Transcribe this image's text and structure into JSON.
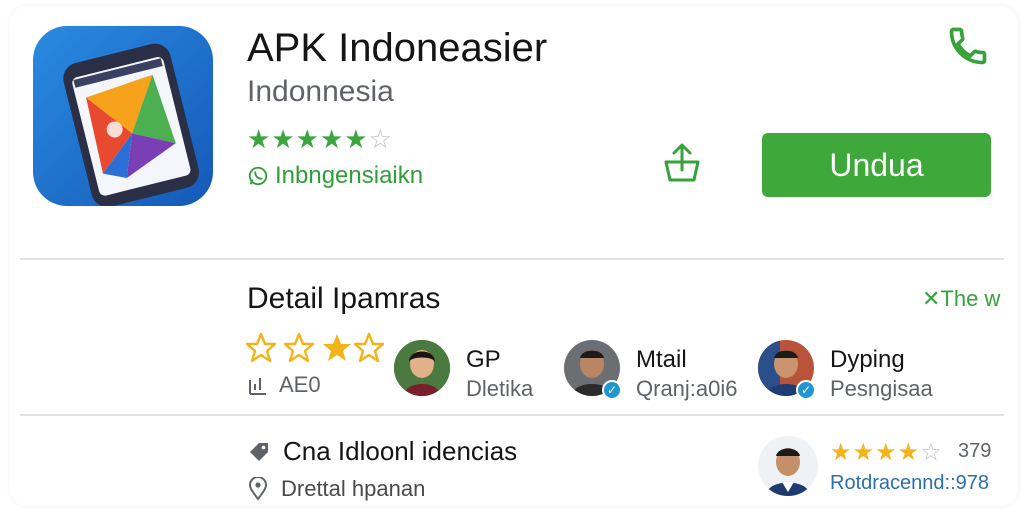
{
  "app": {
    "title": "APK Indoneasier",
    "subtitle": "Indonnesia",
    "rating_filled": 5,
    "rating_total": 6,
    "developer": "Inbngensiaikn",
    "download_label": "Undua",
    "accent_color": "#3fa83a"
  },
  "details": {
    "title": "Detail Ipamras",
    "see_all": "✕The w",
    "stat": "AE0",
    "people": [
      {
        "name": "GP",
        "sub": "Dletika"
      },
      {
        "name": "Mtail",
        "sub": "Qranj:a0i6"
      },
      {
        "name": "Dyping",
        "sub": "Pesngisaa"
      }
    ]
  },
  "bottom": {
    "tag": "Cna Idloonl idencias",
    "location": "Drettal hpanan",
    "review_filled": 4,
    "review_total": 5,
    "review_count": "379",
    "review_link": "Rotdracennd::978",
    "star_color": "#f3b31b"
  },
  "icons": [
    "phone-icon",
    "share-icon",
    "tag-icon",
    "location-pin-icon",
    "verified-badge-icon"
  ]
}
